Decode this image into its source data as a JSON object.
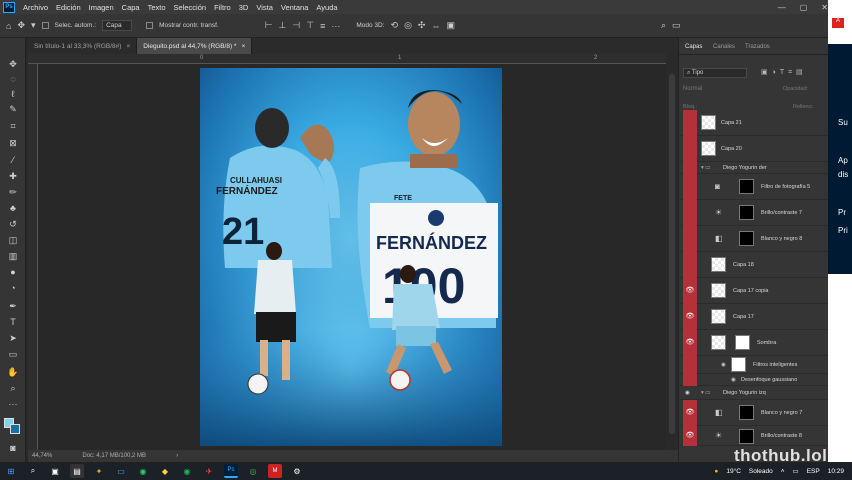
{
  "menubar": {
    "app_logo": "Ps",
    "items": [
      "Archivo",
      "Edición",
      "Imagen",
      "Capa",
      "Texto",
      "Selección",
      "Filtro",
      "3D",
      "Vista",
      "Ventana",
      "Ayuda"
    ]
  },
  "optionsbar": {
    "auto_select_label": "Selec. autom.:",
    "auto_select_value": "Capa",
    "show_transform_label": "Mostrar contr. transf.",
    "mode3d_label": "Modo 3D:"
  },
  "tabs": [
    {
      "label": "Sin título-1 al 33,3% (RGB/8#)",
      "close": "×"
    },
    {
      "label": "Dieguito.psd al 44,7% (RGB/8) *",
      "close": "×"
    }
  ],
  "ruler": {
    "marks": [
      "0",
      "1",
      "2"
    ]
  },
  "artwork": {
    "jersey_name_left": "FERNÁNDEZ",
    "jersey_top_left": "CULLAHUASI",
    "jersey_number": "21",
    "banner_name": "FERNÁNDEZ",
    "banner_number": "100",
    "chest_sponsor": "FETE"
  },
  "status": {
    "zoom": "44,74%",
    "doc": "Doc: 4,17 MB/100,2 MB"
  },
  "layers_panel": {
    "tabs": [
      "Capas",
      "Canales",
      "Trazados"
    ],
    "kind_filter": "Tipo",
    "blend_mode": "Normal",
    "opacity_label": "Opacidad:",
    "lock_label": "Bloq.:",
    "fill_label": "Relleno:",
    "layers": [
      {
        "name": "Capa 21",
        "visible": false
      },
      {
        "name": "Capa 20",
        "visible": false
      },
      {
        "name": "Diego Yogurin der",
        "visible": false,
        "group": true
      },
      {
        "name": "Filtro de fotografía 5",
        "visible": false
      },
      {
        "name": "Brillo/contraste 7",
        "visible": false
      },
      {
        "name": "Blanco y negro 8",
        "visible": false
      },
      {
        "name": "Capa 18",
        "visible": false
      },
      {
        "name": "Capa 17 copia",
        "visible": true
      },
      {
        "name": "Capa 17",
        "visible": true
      },
      {
        "name": "Sombra",
        "visible": true
      },
      {
        "name": "Filtros inteligentes",
        "visible": true
      },
      {
        "name": "Desenfoque gaussiano",
        "visible": true
      },
      {
        "name": "Diego Yogurin izq",
        "visible": true,
        "group": true
      },
      {
        "name": "Blanco y negro 7",
        "visible": true
      },
      {
        "name": "Brillo/contraste 8",
        "visible": true
      }
    ]
  },
  "right_strip": {
    "lines": [
      "Su",
      "Ap",
      "dis",
      "Pr",
      "Pri"
    ]
  },
  "taskbar": {
    "weather_temp": "19°C",
    "weather_desc": "Soleado",
    "language": "ESP",
    "time": "10:29"
  },
  "watermark": "thothub.lol"
}
